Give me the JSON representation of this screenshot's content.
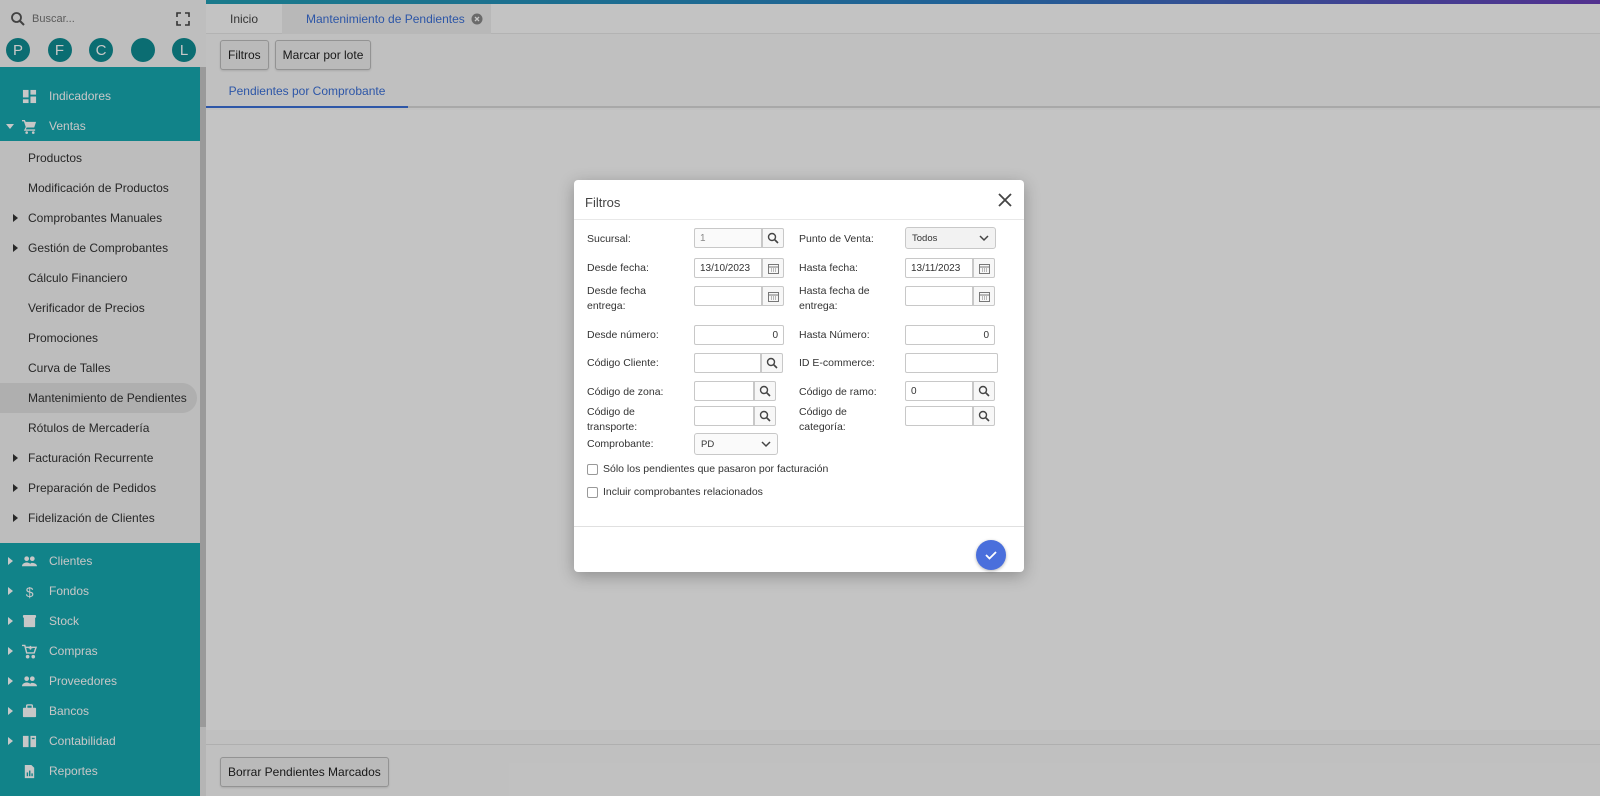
{
  "search": {
    "placeholder": "Buscar..."
  },
  "avatars": [
    "P",
    "F",
    "C",
    "",
    "L"
  ],
  "nav": {
    "top_items": [
      {
        "label": "Indicadores",
        "icon": "dashboard-icon"
      },
      {
        "label": "Ventas",
        "icon": "cart-icon",
        "expanded": true
      }
    ],
    "ventas_sub": [
      {
        "label": "Productos",
        "has_children": false
      },
      {
        "label": "Modificación de Productos",
        "has_children": false
      },
      {
        "label": "Comprobantes Manuales",
        "has_children": true
      },
      {
        "label": "Gestión de Comprobantes",
        "has_children": true
      },
      {
        "label": "Cálculo Financiero",
        "has_children": false
      },
      {
        "label": "Verificador de Precios",
        "has_children": false
      },
      {
        "label": "Promociones",
        "has_children": false
      },
      {
        "label": "Curva de Talles",
        "has_children": false
      },
      {
        "label": "Mantenimiento de Pendientes",
        "has_children": false,
        "active": true
      },
      {
        "label": "Rótulos de Mercadería",
        "has_children": false
      },
      {
        "label": "Facturación Recurrente",
        "has_children": true
      },
      {
        "label": "Preparación de Pedidos",
        "has_children": true
      },
      {
        "label": "Fidelización de Clientes",
        "has_children": true
      }
    ],
    "bottom_items": [
      {
        "label": "Clientes",
        "icon": "people-icon"
      },
      {
        "label": "Fondos",
        "icon": "dollar-icon"
      },
      {
        "label": "Stock",
        "icon": "box-icon"
      },
      {
        "label": "Compras",
        "icon": "cart-add-icon"
      },
      {
        "label": "Proveedores",
        "icon": "people-icon"
      },
      {
        "label": "Bancos",
        "icon": "briefcase-icon"
      },
      {
        "label": "Contabilidad",
        "icon": "book-icon"
      },
      {
        "label": "Reportes",
        "icon": "report-icon"
      }
    ]
  },
  "tabs": {
    "home": "Inicio",
    "active": "Mantenimiento de Pendientes"
  },
  "toolbar": {
    "filters": "Filtros",
    "batch": "Marcar por lote"
  },
  "subtab": "Pendientes por Comprobante",
  "footer": {
    "delete_button": "Borrar Pendientes Marcados"
  },
  "modal": {
    "title": "Filtros",
    "labels": {
      "sucursal": "Sucursal:",
      "punto_venta": "Punto de Venta:",
      "desde_fecha": "Desde fecha:",
      "hasta_fecha": "Hasta fecha:",
      "desde_entrega_1": "Desde fecha",
      "desde_entrega_2": "entrega:",
      "hasta_entrega_1": "Hasta fecha de",
      "hasta_entrega_2": "entrega:",
      "desde_numero": "Desde número:",
      "hasta_numero": "Hasta Número:",
      "codigo_cliente": "Código Cliente:",
      "id_ecommerce": "ID E-commerce:",
      "codigo_zona": "Código de zona:",
      "codigo_ramo": "Código de ramo:",
      "codigo_transporte_1": "Código de",
      "codigo_transporte_2": "transporte:",
      "codigo_categoria_1": "Código de",
      "codigo_categoria_2": "categoría:",
      "comprobante": "Comprobante:"
    },
    "values": {
      "sucursal": "1",
      "punto_venta": "Todos",
      "desde_fecha": "13/10/2023",
      "hasta_fecha": "13/11/2023",
      "desde_numero": "0",
      "hasta_numero": "0",
      "codigo_ramo": "0",
      "comprobante": "PD"
    },
    "checkboxes": {
      "solo_facturados": "Sólo los pendientes que pasaron por facturación",
      "incluir_relacionados": "Incluir comprobantes relacionados"
    }
  }
}
